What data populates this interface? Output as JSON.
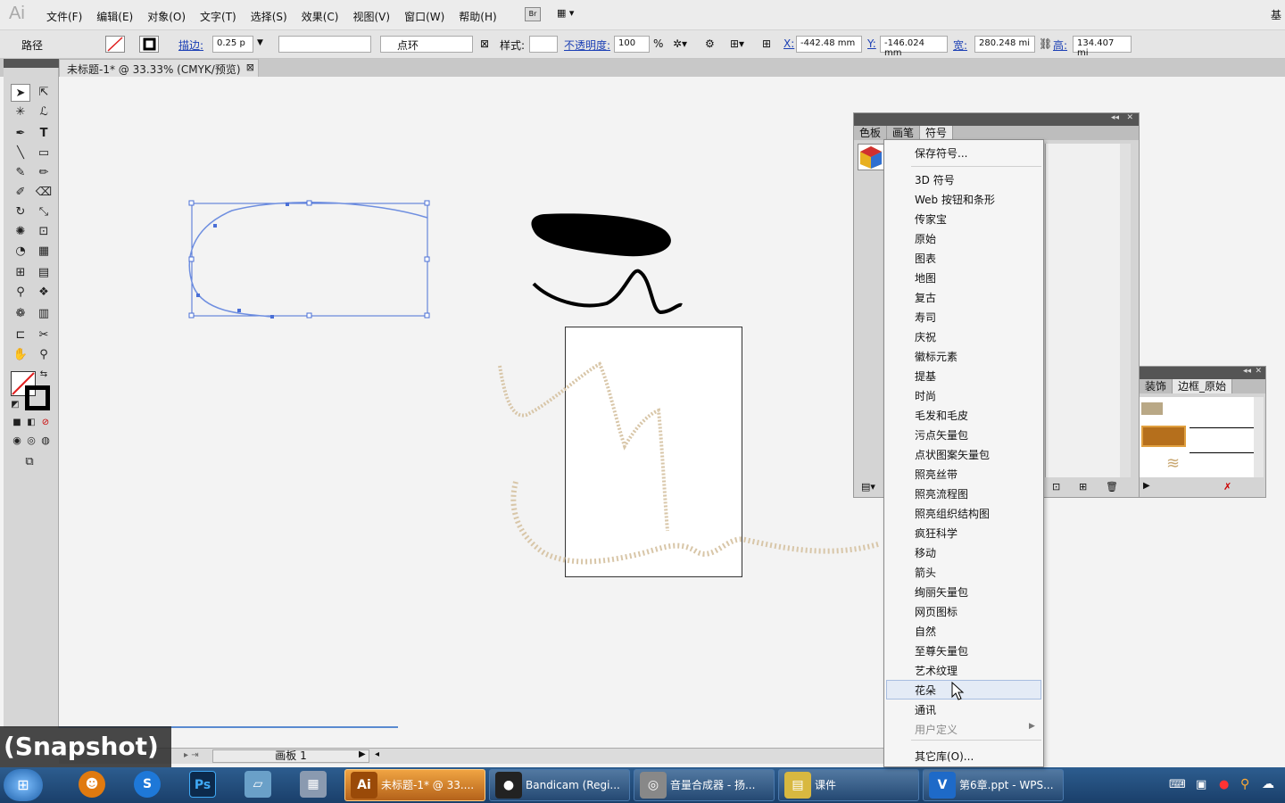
{
  "app": {
    "logo": "Ai"
  },
  "menubar": {
    "items": [
      "文件(F)",
      "编辑(E)",
      "对象(O)",
      "文字(T)",
      "选择(S)",
      "效果(C)",
      "视图(V)",
      "窗口(W)",
      "帮助(H)"
    ],
    "bridge_label": "Br",
    "right_label": "基"
  },
  "control_bar": {
    "object_type": "路径",
    "stroke_label": "描边:",
    "stroke_weight": "0.25 p",
    "brush_name": "点环",
    "style_label": "样式:",
    "opacity_label": "不透明度:",
    "opacity_value": "100",
    "opacity_unit": "%",
    "x_label": "X:",
    "x_value": "-442.48 mm",
    "y_label": "Y:",
    "y_value": "-146.024 mm",
    "w_label": "宽:",
    "w_value": "280.248 mi",
    "h_label": "高:",
    "h_value": "134.407 mi"
  },
  "document": {
    "tab_title": "未标题-1* @ 33.33% (CMYK/预览)",
    "artboard_nav": "画板 1"
  },
  "symbols_panel": {
    "tabs": [
      "色板",
      "画笔",
      "符号"
    ],
    "active_tab": "符号"
  },
  "brush_panel": {
    "tabs": [
      "装饰",
      "边框_原始"
    ]
  },
  "dropdown": {
    "save_item": "保存符号...",
    "libraries": [
      "3D 符号",
      "Web 按钮和条形",
      "传家宝",
      "原始",
      "图表",
      "地图",
      "复古",
      "寿司",
      "庆祝",
      "徽标元素",
      "提基",
      "时尚",
      "毛发和毛皮",
      "污点矢量包",
      "点状图案矢量包",
      "照亮丝带",
      "照亮流程图",
      "照亮组织结构图",
      "疯狂科学",
      "移动",
      "箭头",
      "绚丽矢量包",
      "网页图标",
      "自然",
      "至尊矢量包",
      "艺术纹理",
      "花朵",
      "通讯"
    ],
    "highlighted": "花朵",
    "user_defined": "用户定义",
    "other_library": "其它库(O)..."
  },
  "taskbar": {
    "buttons": [
      {
        "label": "未标题-1* @ 33....",
        "icon": "Ai",
        "active": true
      },
      {
        "label": "Bandicam (Regi...",
        "icon": "●",
        "active": false
      },
      {
        "label": "音量合成器 - 扬...",
        "icon": "◎",
        "active": false
      },
      {
        "label": "课件",
        "icon": "▤",
        "active": false
      },
      {
        "label": "第6章.ppt - WPS...",
        "icon": "V",
        "active": false
      }
    ],
    "pinned": [
      "Ps"
    ]
  },
  "overlay": {
    "snapshot_label": "(Snapshot)"
  },
  "colors": {
    "accent": "#1b3fb5",
    "selection": "#4a6fd6",
    "taskbar": "#1f4a7a"
  }
}
